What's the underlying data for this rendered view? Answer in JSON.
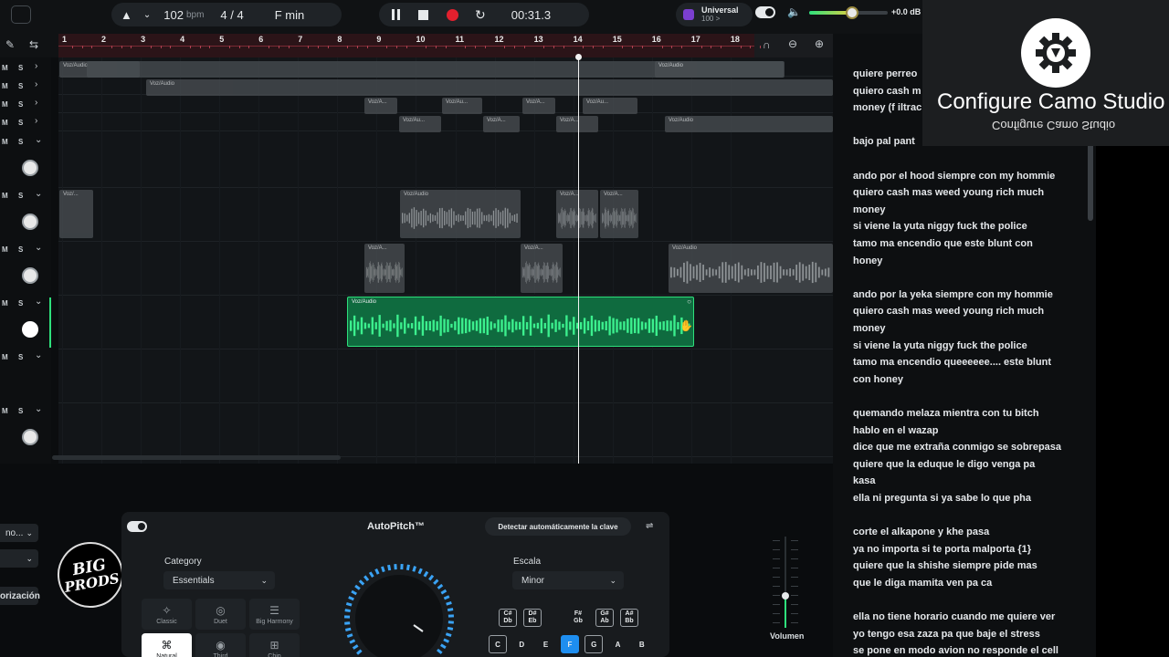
{
  "transport": {
    "tempo_value": "102",
    "tempo_unit": "bpm",
    "time_signature": "4 / 4",
    "key": "F min",
    "time_position": "00:31.3",
    "preset_name": "Universal",
    "preset_sub": "100 >",
    "output_level": "+0.0 dB",
    "volume_fraction": 0.55
  },
  "ruler": {
    "bars": [
      "1",
      "2",
      "3",
      "4",
      "5",
      "6",
      "7",
      "8",
      "9",
      "10",
      "11",
      "12",
      "13",
      "14",
      "15",
      "16",
      "17",
      "18"
    ]
  },
  "tracks": {
    "mute_label": "M",
    "solo_label": "S",
    "clip_label": "Voz/Audio",
    "clip_label_short": "Voz/A...",
    "clip_label_shorter": "Voz/Au...",
    "clip_label_tiny": "Voz/..."
  },
  "lower_left": {
    "dropdown_1": "no...",
    "dropdown_2": "",
    "button_label": "orización"
  },
  "logo": {
    "line1": "BIG",
    "line2": "PRODS"
  },
  "autopitch": {
    "title": "AutoPitch™",
    "detect_label": "Detectar automáticamente la clave",
    "category_label": "Category",
    "category_value": "Essentials",
    "scale_label": "Escala",
    "scale_value": "Minor",
    "styles": [
      "Classic",
      "Duet",
      "Big Harmony",
      "Natural",
      "Third",
      "Chip"
    ],
    "volume_label": "Volumen",
    "volume_fraction": 0.35,
    "sharp_keys": [
      [
        "C#",
        "Db"
      ],
      [
        "D#",
        "Eb"
      ],
      [
        "F#",
        "Gb"
      ],
      [
        "G#",
        "Ab"
      ],
      [
        "A#",
        "Bb"
      ]
    ],
    "natural_keys": [
      "C",
      "D",
      "E",
      "F",
      "G",
      "A",
      "B"
    ],
    "selected_key": "F"
  },
  "lyrics": [
    "quiere perreo",
    "quiero cash m",
    "money (f iltrac",
    "",
    "bajo pal pant",
    "",
    "ando por el hood siempre con my hommie",
    "quiero cash mas weed  young rich  much",
    "money",
    "si viene la yuta niggy fuck the police",
    " tamo ma encendio que este blunt con",
    "honey",
    "",
    " ando por la  yeka siempre con my hommie",
    "quiero cash mas weed  young rich  much",
    "money",
    "si viene la yuta niggy fuck the police",
    " tamo ma encendio queeeeee.... este blunt",
    "con honey",
    "",
    "quemando melaza mientra con tu bitch",
    "hablo en el wazap",
    "dice que me extraña conmigo se sobrepasa",
    " quiere que la eduque le digo venga pa",
    "kasa",
    "ella ni pregunta si ya sabe lo que pha",
    "",
    " corte el alkapone y khe pasa",
    "ya no importa si te porta malporta {1}",
    "quiere que la shishe siempre pide mas",
    "que  le diga mamita ven  pa ca",
    "",
    "ella no tiene horario cuando me quiere ver",
    "yo tengo esa zaza pa que baje el stress",
    " se pone en  modo avion no responde el cell"
  ],
  "camo": {
    "title": "Configure Camo Studio",
    "subtitle": "Configure Camo Studio"
  },
  "colors": {
    "accent_green": "#2ee07c",
    "record_red": "#e2202e",
    "ruler_red": "#2b1418",
    "selected_blue": "#1e8ef0"
  }
}
